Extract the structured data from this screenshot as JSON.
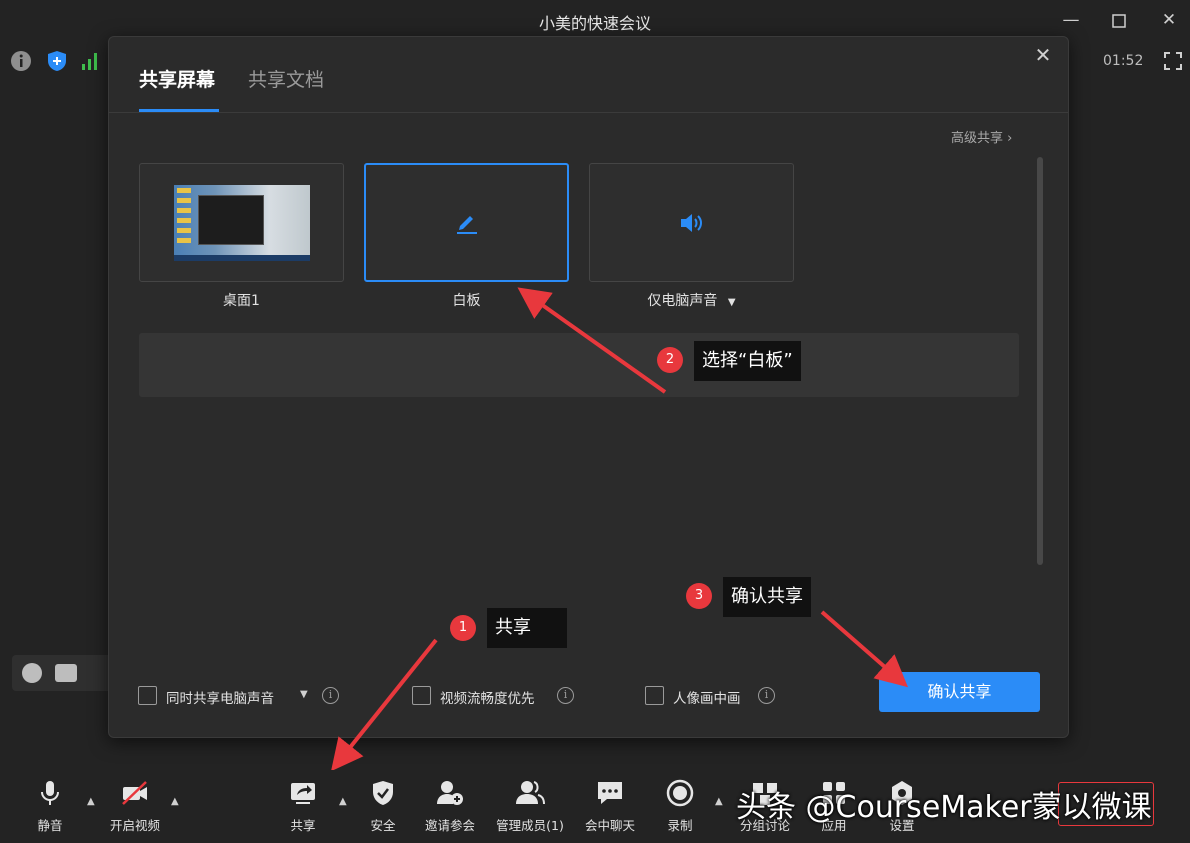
{
  "window": {
    "title": "小美的快速会议",
    "timer": "01:52"
  },
  "dialog": {
    "tabs": [
      {
        "label": "共享屏幕",
        "active": true
      },
      {
        "label": "共享文档",
        "active": false
      }
    ],
    "advanced_share": "高级共享 ›",
    "tiles": [
      {
        "label": "桌面1",
        "icon": "desktop-preview",
        "selected": false
      },
      {
        "label": "白板",
        "icon": "pencil-icon",
        "selected": true
      },
      {
        "label": "仅电脑声音",
        "icon": "speaker-icon",
        "selected": false,
        "has_dropdown": true
      }
    ],
    "options": [
      {
        "label": "同时共享电脑声音",
        "checked": false,
        "has_dropdown": true
      },
      {
        "label": "视频流畅度优先",
        "checked": false
      },
      {
        "label": "人像画中画",
        "checked": false
      }
    ],
    "confirm_button": "确认共享"
  },
  "annotations": [
    {
      "number": "1",
      "text": "共享"
    },
    {
      "number": "2",
      "text": "选择“白板”"
    },
    {
      "number": "3",
      "text": "确认共享"
    }
  ],
  "toolbar": {
    "items": [
      {
        "label": "静音",
        "icon": "microphone-icon"
      },
      {
        "label": "开启视频",
        "icon": "camera-off-icon"
      },
      {
        "label": "共享",
        "icon": "share-screen-icon"
      },
      {
        "label": "安全",
        "icon": "shield-check-icon"
      },
      {
        "label": "邀请参会",
        "icon": "invite-user-icon"
      },
      {
        "label": "管理成员(1)",
        "icon": "members-icon"
      },
      {
        "label": "会中聊天",
        "icon": "chat-icon"
      },
      {
        "label": "录制",
        "icon": "record-icon"
      },
      {
        "label": "分组讨论",
        "icon": "breakout-icon"
      },
      {
        "label": "应用",
        "icon": "apps-icon"
      },
      {
        "label": "设置",
        "icon": "settings-icon"
      }
    ]
  },
  "watermark": "头条 @CourseMaker蒙以微课",
  "colors": {
    "accent": "#2b8cf7",
    "annotation_red": "#e8383d",
    "background": "#232323",
    "dialog": "#2b2b2b"
  }
}
